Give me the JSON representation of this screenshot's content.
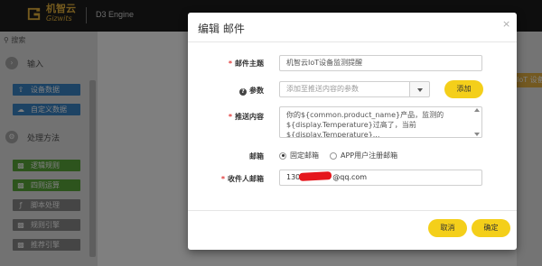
{
  "app": {
    "logo_cn": "机智云",
    "logo_en": "Gizwits",
    "name": "D3 Engine"
  },
  "sidebar": {
    "search_label": "搜索",
    "categories": [
      {
        "label": "输入",
        "icon": "arrow-icon"
      },
      {
        "label": "处理方法",
        "icon": "gear-icon"
      }
    ],
    "input_blocks": [
      {
        "label": "设备数据",
        "color": "#3a86c8",
        "icon": "upload-icon"
      },
      {
        "label": "自定义数据",
        "color": "#3a86c8",
        "icon": "cloud-upload-icon"
      }
    ],
    "method_blocks": [
      {
        "label": "逻辑规则",
        "color": "#5aa83a",
        "icon": "puzzle-icon"
      },
      {
        "label": "四则运算",
        "color": "#5aa83a",
        "icon": "puzzle-icon"
      },
      {
        "label": "脚本处理",
        "color": "#8a8a8a",
        "icon": "function-icon"
      },
      {
        "label": "规则引擎",
        "color": "#8a8a8a",
        "icon": "puzzle-icon"
      },
      {
        "label": "推荐引擎",
        "color": "#8a8a8a",
        "icon": "puzzle-icon"
      }
    ],
    "right_tab": "IoT 设备"
  },
  "modal": {
    "title": "编辑 邮件",
    "close": "×",
    "subject": {
      "label": "邮件主题",
      "value": "机智云IoT设备监测提醒"
    },
    "params": {
      "label": "参数",
      "placeholder": "添加至推送内容的参数",
      "add_button": "添加"
    },
    "content": {
      "label": "推送内容",
      "value": "你的${common.product_name}产品，监测的${display.Temperature}过高了，当前${display.Temperature}..."
    },
    "mailbox": {
      "label": "邮箱",
      "options": [
        {
          "label": "固定邮箱",
          "selected": true
        },
        {
          "label": "APP用户注册邮箱",
          "selected": false
        }
      ]
    },
    "recipient": {
      "label": "收件人邮箱",
      "value_prefix": "130",
      "value_suffix": "@qq.com"
    },
    "cancel_button": "取消",
    "confirm_button": "确定"
  },
  "colors": {
    "accent": "#f4cf1a",
    "required": "#e23b3b"
  }
}
